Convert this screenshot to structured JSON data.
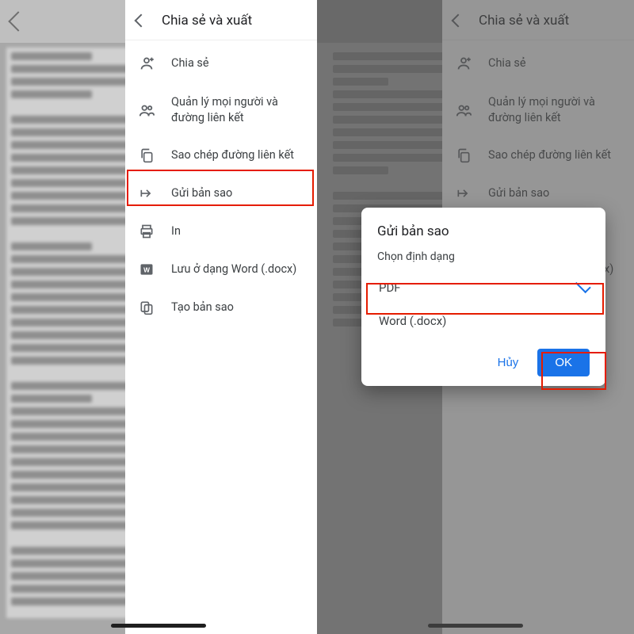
{
  "panel": {
    "title": "Chia sẻ và xuất"
  },
  "menu": {
    "share": {
      "label": "Chia sẻ"
    },
    "manage": {
      "label": "Quản lý mọi người và đường liên kết"
    },
    "copylink": {
      "label": "Sao chép đường liên kết"
    },
    "sendcopy": {
      "label": "Gửi bản sao"
    },
    "print": {
      "label": "In"
    },
    "saveword": {
      "label": "Lưu ở dạng Word (.docx)"
    },
    "makecopy": {
      "label": "Tạo bản sao"
    }
  },
  "dialog": {
    "title": "Gửi bản sao",
    "subtitle": "Chọn định dạng",
    "opt_pdf": "PDF",
    "opt_docx": "Word (.docx)",
    "cancel": "Hủy",
    "ok": "OK"
  }
}
